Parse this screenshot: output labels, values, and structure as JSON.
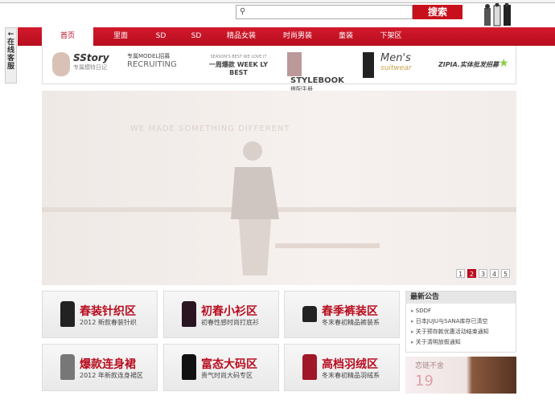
{
  "search": {
    "placeholder": "",
    "button": "搜索"
  },
  "side_tab": {
    "arrow": "←",
    "label": "在线客服"
  },
  "nav": [
    "首页",
    "里面",
    "SD",
    "SD",
    "精品女装",
    "时尚男装",
    "童装",
    "下架区"
  ],
  "logos": [
    {
      "title": "SStory",
      "sub": "专属模特日记"
    },
    {
      "title": "专属MODEL招募",
      "sub": "RECRUITING"
    },
    {
      "title": "SEASON'S BEST WE LOVE IT",
      "sub": "一周爆款 WEEK LY BEST"
    },
    {
      "title": "STYLEBOOK",
      "sub": "搭配手册"
    },
    {
      "title": "Men's",
      "sub": "suitwear"
    },
    {
      "title": "ZIPIA.实体批发招募",
      "sub": ""
    }
  ],
  "banner": {
    "text": "WE MADE SOMETHING DIFFERENT",
    "pages": [
      "1",
      "2",
      "3",
      "4",
      "5"
    ],
    "active_page": 2
  },
  "tiles": [
    {
      "title": "春装针织区",
      "sub": "2012 新款春装针织"
    },
    {
      "title": "初春小衫区",
      "sub": "初春性感时尚打底衫"
    },
    {
      "title": "春季裤装区",
      "sub": "冬末春初精品裤装系"
    },
    {
      "title": "爆款连身裙",
      "sub": "2012 年新款连身裙区"
    },
    {
      "title": "富态大码区",
      "sub": "贵气时尚大码专区"
    },
    {
      "title": "高档羽绒区",
      "sub": "冬末春初精品羽绒系"
    }
  ],
  "notice": {
    "title": "最新公告",
    "items": [
      "SDDF",
      "日本JUJU与SANA库存已清空",
      "关于预存款优惠活动结束通知",
      "关于清明放假通知"
    ]
  },
  "ad": {
    "title": "恋链不舍",
    "price": "19"
  }
}
